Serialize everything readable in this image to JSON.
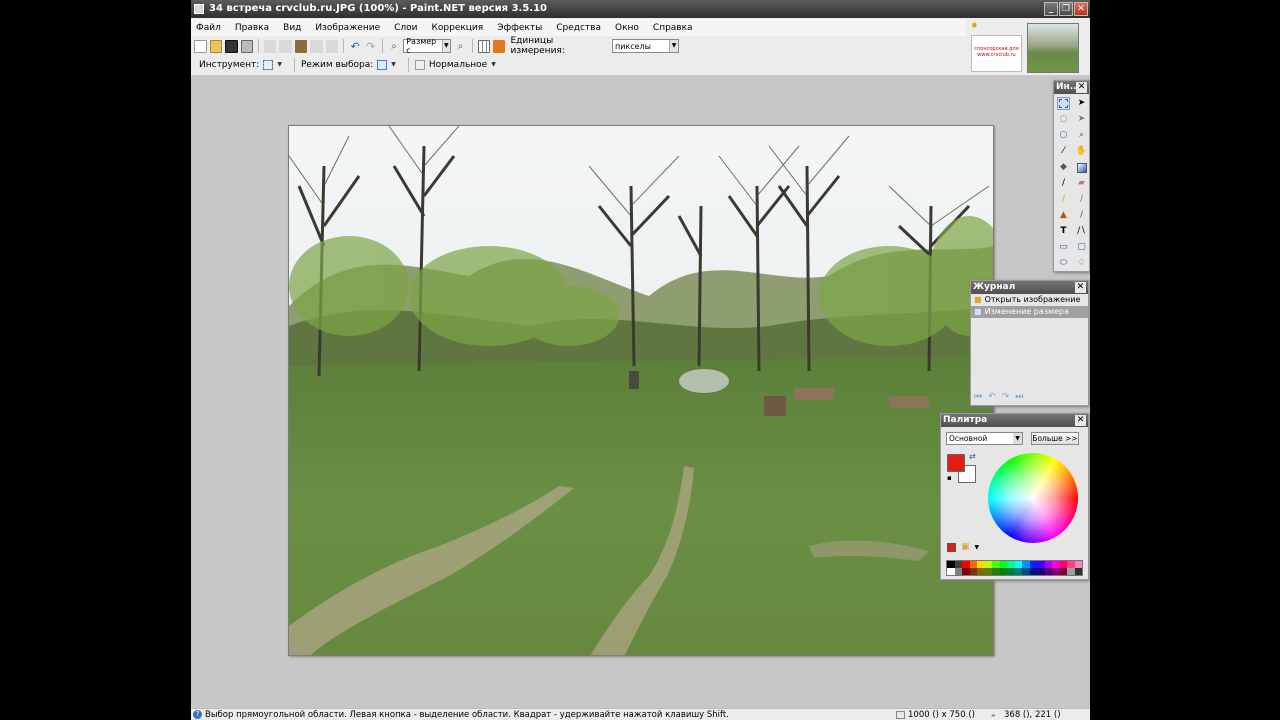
{
  "window": {
    "title": "34 встреча crvclub.ru.JPG (100%) - Paint.NET версия 3.5.10",
    "buttons": [
      "_",
      "❐",
      "✕"
    ]
  },
  "menu": {
    "items": [
      "Файл",
      "Правка",
      "Вид",
      "Изображение",
      "Слои",
      "Коррекция",
      "Эффекты",
      "Средства",
      "Окно",
      "Справка"
    ]
  },
  "toolbar": {
    "size_dropdown": "Размер с",
    "units_label": "Единицы измерения:",
    "units_value": "пикселы"
  },
  "toolbar2": {
    "tool_label": "Инструмент:",
    "selection_mode_label": "Режим выбора:",
    "blend_mode_value": "Нормальное"
  },
  "thumbnails": {
    "thumb1_text": "спонсорская для www.crvclub.ru"
  },
  "tools_panel": {
    "title": "Ин...",
    "close": "✕"
  },
  "history_panel": {
    "title": "Журнал",
    "close": "✕",
    "items": [
      "Открыть изображение",
      "Изменение размера"
    ]
  },
  "palette_panel": {
    "title": "Палитра",
    "close": "✕",
    "mode_value": "Основной",
    "more_button": "Больше >>",
    "primary_color": "#e01e14",
    "secondary_color": "#ffffff"
  },
  "status": {
    "help_text": "Выбор прямоугольной области. Левая кнопка - выделение области. Квадрат - удерживайте нажатой клавишу Shift.",
    "image_size": "1000 () x 750 ()",
    "cursor_pos": "368 (), 221 ()"
  },
  "colors": {
    "titlebar": "#3d3d3d",
    "canvas_bg": "#c7c7c7",
    "selection_highlight": "#9f9f9f"
  }
}
